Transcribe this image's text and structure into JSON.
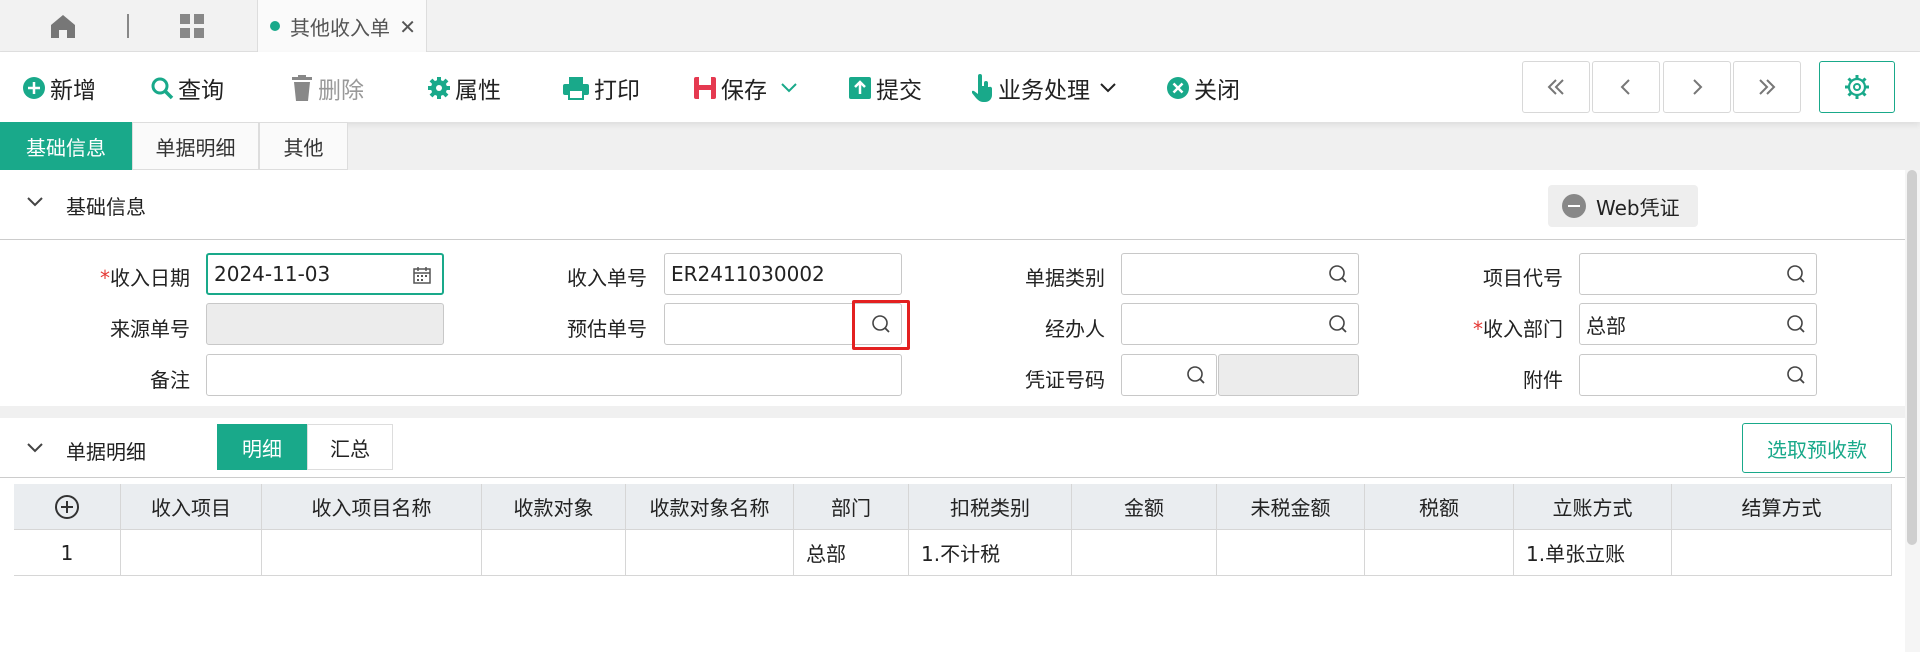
{
  "tabbar": {
    "doc_tab_label": "其他收入单",
    "close_glyph": "✕"
  },
  "toolbar": {
    "new": "新增",
    "query": "查询",
    "delete": "删除",
    "properties": "属性",
    "print": "打印",
    "save": "保存",
    "submit": "提交",
    "business": "业务处理",
    "close": "关闭"
  },
  "page_tabs": [
    "基础信息",
    "单据明细",
    "其他"
  ],
  "basic": {
    "section_title": "基础信息",
    "web_voucher": "Web凭证",
    "fields": {
      "income_date_label": "收入日期",
      "income_date_value": "2024-11-03",
      "income_no_label": "收入单号",
      "income_no_value": "ER2411030002",
      "doc_type_label": "单据类别",
      "project_code_label": "项目代号",
      "source_no_label": "来源单号",
      "estimate_no_label": "预估单号",
      "handler_label": "经办人",
      "income_dept_label": "收入部门",
      "income_dept_value": "总部",
      "remark_label": "备注",
      "voucher_no_label": "凭证号码",
      "attachment_label": "附件"
    },
    "required_mark": "*"
  },
  "detail": {
    "section_title": "单据明细",
    "sub_tabs": [
      "明细",
      "汇总"
    ],
    "pick_button": "选取预收款",
    "columns": [
      "收入项目",
      "收入项目名称",
      "收款对象",
      "收款对象名称",
      "部门",
      "扣税类别",
      "金额",
      "未税金额",
      "税额",
      "立账方式",
      "结算方式"
    ],
    "rows": [
      {
        "no": "1",
        "dept": "总部",
        "tax_type": "1.不计税",
        "account_method": "1.单张立账"
      }
    ]
  },
  "colors": {
    "accent": "#19a98a",
    "highlight": "#e32020",
    "required": "#e53935"
  }
}
